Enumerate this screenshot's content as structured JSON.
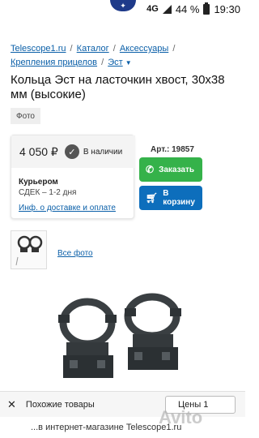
{
  "status": {
    "network": "4G",
    "battery": "44 %",
    "time": "19:30"
  },
  "breadcrumb": {
    "items": [
      "Telescope1.ru",
      "Каталог",
      "Аксессуары",
      "Крепления прицелов",
      "Эст"
    ]
  },
  "product": {
    "title": "Кольца Эст на ласточкин хвост, 30х38 мм (высокие)",
    "photo_tab": "Фото",
    "price": "4 050 ₽",
    "stock": "В наличии",
    "courier_label": "Курьером",
    "courier_desc": "СДЕК – 1-2 дня",
    "delivery_link": "Инф. о доставке и оплате",
    "article": "Арт.: 19857",
    "order_button": "Заказать",
    "cart_button": "В корзину",
    "all_photos": "Все фото"
  },
  "bottom": {
    "similar": "Похожие товары",
    "price_sort": "Цены 1"
  },
  "footer": {
    "text": "...в интернет-магазине Telescope1.ru"
  },
  "watermark": "Avito",
  "colors": {
    "link": "#0a5fa8",
    "order_green": "#35b24a",
    "cart_blue": "#0d6ebc"
  }
}
